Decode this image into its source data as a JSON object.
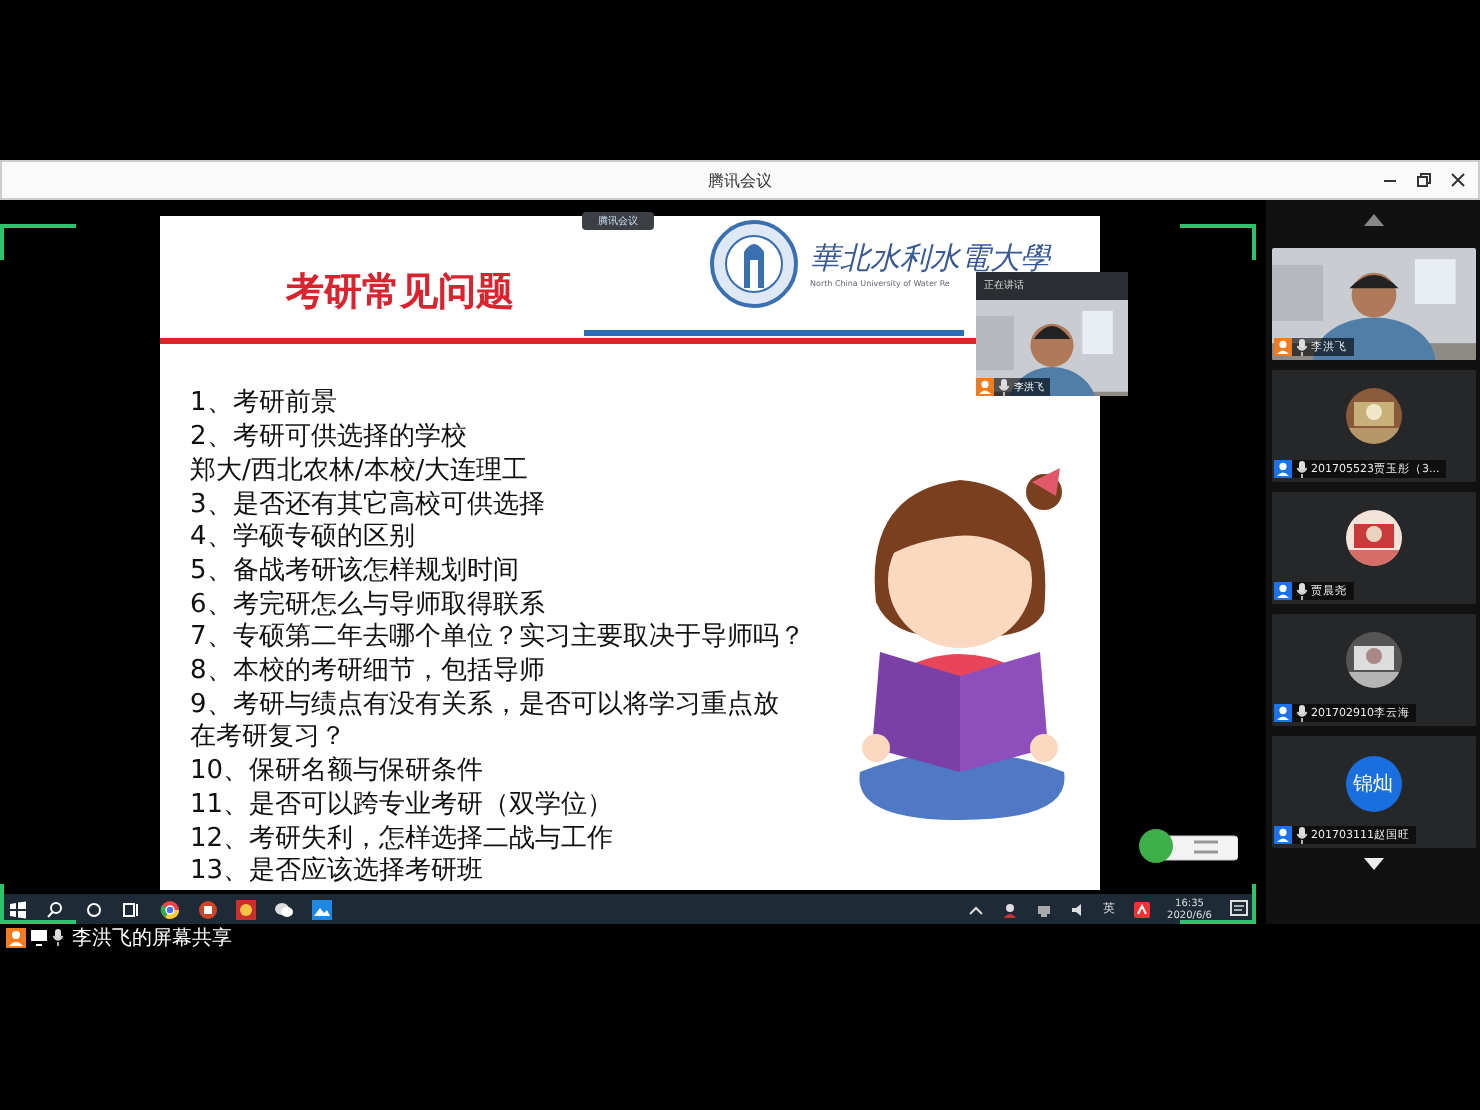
{
  "window": {
    "title": "腾讯会议"
  },
  "share_badge": "腾讯会议",
  "slide": {
    "title": "考研常见问题",
    "logo_text": "華北水利水電大學",
    "logo_subtitle": "North China University of Water Re",
    "lines": [
      "1、考研前景",
      "2、考研可供选择的学校",
      "郑大/西北农林/本校/大连理工",
      "3、是否还有其它高校可供选择",
      "4、学硕专硕的区别",
      "5、备战考研该怎样规划时间",
      "6、考完研怎么与导师取得联系",
      "7、专硕第二年去哪个单位？实习主要取决于导师吗？",
      "8、本校的考研细节，包括导师",
      "9、考研与绩点有没有关系，是否可以将学习重点放",
      "在考研复习？",
      "10、保研名额与保研条件",
      "11、是否可以跨专业考研（双学位）",
      "12、考研失利，怎样选择二战与工作",
      "13、是否应该选择考研班"
    ]
  },
  "speaker": {
    "label": "正在讲话",
    "name": "李洪飞",
    "host": true
  },
  "participants": [
    {
      "name": "李洪飞",
      "kind": "video",
      "host": true
    },
    {
      "name": "201705523贾玉彤（3...",
      "kind": "avatar",
      "host": false
    },
    {
      "name": "贾晨尧",
      "kind": "avatar",
      "host": false
    },
    {
      "name": "201702910李云海",
      "kind": "avatar",
      "host": false
    },
    {
      "name": "201703111赵国旺",
      "kind": "initials",
      "initials": "锦灿",
      "host": false
    }
  ],
  "taskbar": {
    "ime": "英",
    "time": "16:35",
    "date": "2020/6/6"
  },
  "share_bar": {
    "text": "李洪飞的屏幕共享"
  }
}
